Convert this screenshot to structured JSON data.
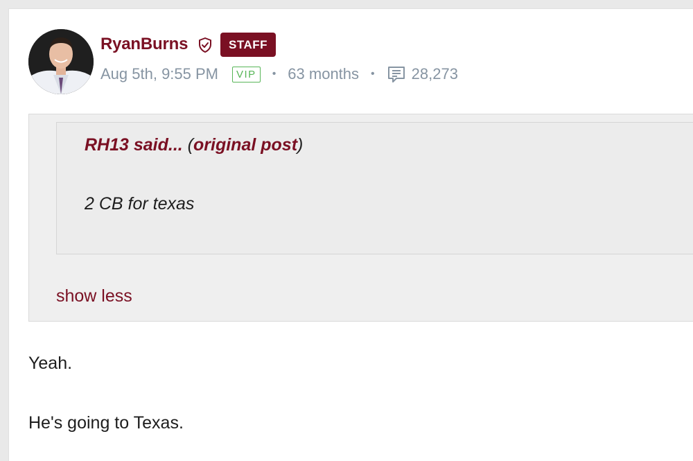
{
  "post": {
    "author": {
      "username": "RyanBurns",
      "role_badge": "STAFF"
    },
    "meta": {
      "timestamp": "Aug 5th, 9:55 PM",
      "vip_label": "VIP",
      "separator": "•",
      "tenure": "63 months",
      "post_count": "28,273"
    },
    "quote": {
      "author_said": "RH13 said...",
      "open_paren": " (",
      "original_post_link": "original post",
      "close_paren": ")",
      "body": "2 CB for texas",
      "toggle_label": "show less"
    },
    "body_lines": [
      "Yeah.",
      "He's going to Texas."
    ]
  },
  "colors": {
    "brand": "#7a1023",
    "meta_text": "#8694a2",
    "vip_green": "#57b557",
    "quote_bg": "#efefef"
  },
  "icons": {
    "verified": "shield-check-icon",
    "posts": "comment-icon"
  }
}
